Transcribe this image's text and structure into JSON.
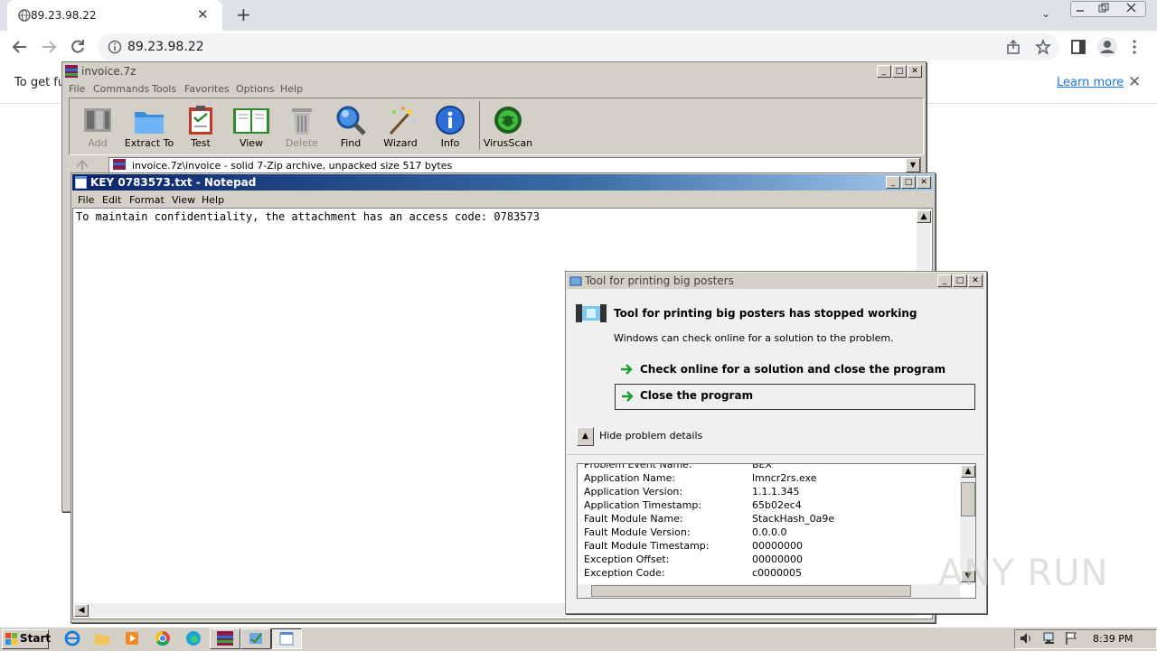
{
  "browser": {
    "tab_title": "89.23.98.22",
    "tab_close": "✕",
    "new_tab": "+",
    "tab_menu": "⌄",
    "url": "89.23.98.22",
    "infobar_text": "To get fu",
    "learn_more": "Learn more",
    "infobar_close": "✕"
  },
  "sevenzip": {
    "title": "invoice.7z",
    "menu": [
      "File",
      "Commands",
      "Tools",
      "Favorites",
      "Options",
      "Help"
    ],
    "tools": [
      {
        "label": "Add",
        "disabled": true,
        "icon": "add-icon"
      },
      {
        "label": "Extract To",
        "disabled": false,
        "icon": "extract-folder-icon"
      },
      {
        "label": "Test",
        "disabled": false,
        "icon": "test-clipboard-icon"
      },
      {
        "label": "View",
        "disabled": false,
        "icon": "view-book-icon"
      },
      {
        "label": "Delete",
        "disabled": true,
        "icon": "delete-trash-icon"
      },
      {
        "label": "Find",
        "disabled": false,
        "icon": "find-magnifier-icon"
      },
      {
        "label": "Wizard",
        "disabled": false,
        "icon": "wizard-wand-icon"
      },
      {
        "label": "Info",
        "disabled": false,
        "icon": "info-icon"
      },
      {
        "label": "VirusScan",
        "disabled": false,
        "icon": "virusscan-bug-icon"
      }
    ],
    "path": "invoice.7z\\invoice - solid 7-Zip archive, unpacked size 517 bytes"
  },
  "notepad": {
    "title": "KEY 0783573.txt - Notepad",
    "menu": [
      "File",
      "Edit",
      "Format",
      "View",
      "Help"
    ],
    "content": "To maintain confidentiality, the attachment has an access code: 0783573"
  },
  "error_dialog": {
    "title": "Tool for printing big posters",
    "heading": "Tool for printing big posters has stopped working",
    "subtext": "Windows can check online for a solution to the problem.",
    "option_check": "Check online for a solution and close the program",
    "option_close": "Close the program",
    "hide_details": "Hide problem details",
    "details": [
      {
        "key": "Problem Event Name:",
        "value": "BEX"
      },
      {
        "key": "Application Name:",
        "value": "lmncr2rs.exe"
      },
      {
        "key": "Application Version:",
        "value": "1.1.1.345"
      },
      {
        "key": "Application Timestamp:",
        "value": "65b02ec4"
      },
      {
        "key": "Fault Module Name:",
        "value": "StackHash_0a9e"
      },
      {
        "key": "Fault Module Version:",
        "value": "0.0.0.0"
      },
      {
        "key": "Fault Module Timestamp:",
        "value": "00000000"
      },
      {
        "key": "Exception Offset:",
        "value": "00000000"
      },
      {
        "key": "Exception Code:",
        "value": "c0000005"
      }
    ]
  },
  "taskbar": {
    "start": "Start",
    "clock": "8:39 PM"
  },
  "watermark": "ANY RUN",
  "colors": {
    "win_face": "#d4d0c8",
    "active_title": "#0a246a",
    "link_blue": "#1a73e8",
    "green_arrow": "#1e9e2e"
  }
}
